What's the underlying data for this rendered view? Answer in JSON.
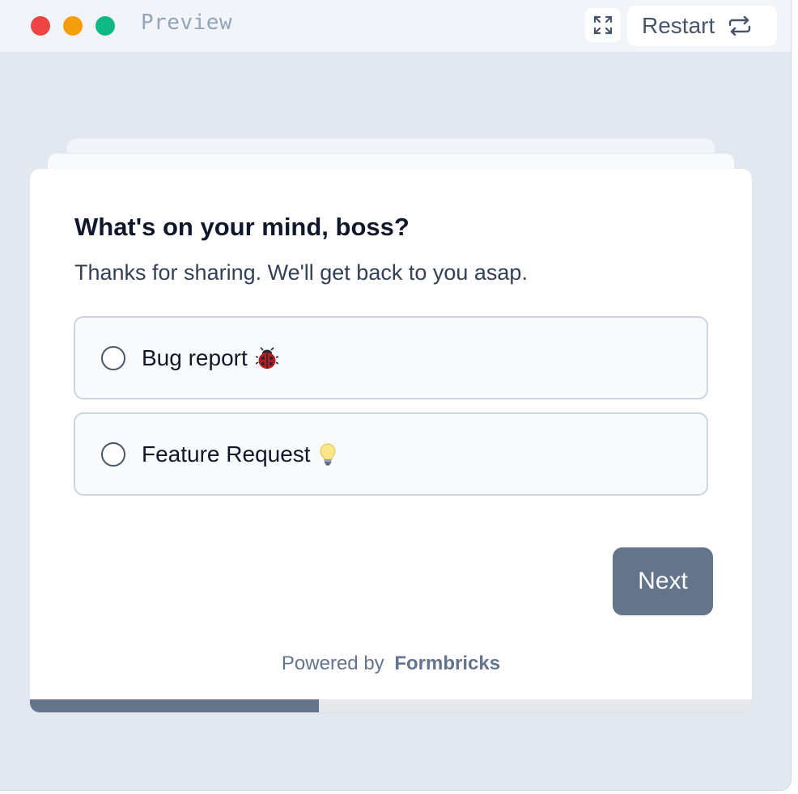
{
  "window": {
    "title": "Preview",
    "controls": {
      "close_color": "#ef4444",
      "minimize_color": "#f59e0b",
      "maximize_color": "#10b981"
    }
  },
  "toolbar": {
    "expand_icon": "expand-arrows-icon",
    "restart_label": "Restart",
    "restart_icon": "repeat-icon"
  },
  "survey": {
    "question": "What's on your mind, boss?",
    "subheader": "Thanks for sharing. We'll get back to you asap.",
    "options": [
      {
        "label": "Bug report",
        "emoji": "ladybug-icon"
      },
      {
        "label": "Feature Request",
        "emoji": "lightbulb-icon"
      }
    ],
    "next_label": "Next",
    "powered_by_prefix": "Powered by",
    "powered_by_brand": "Formbricks",
    "progress": 0.4,
    "accent_color": "#64748b"
  }
}
